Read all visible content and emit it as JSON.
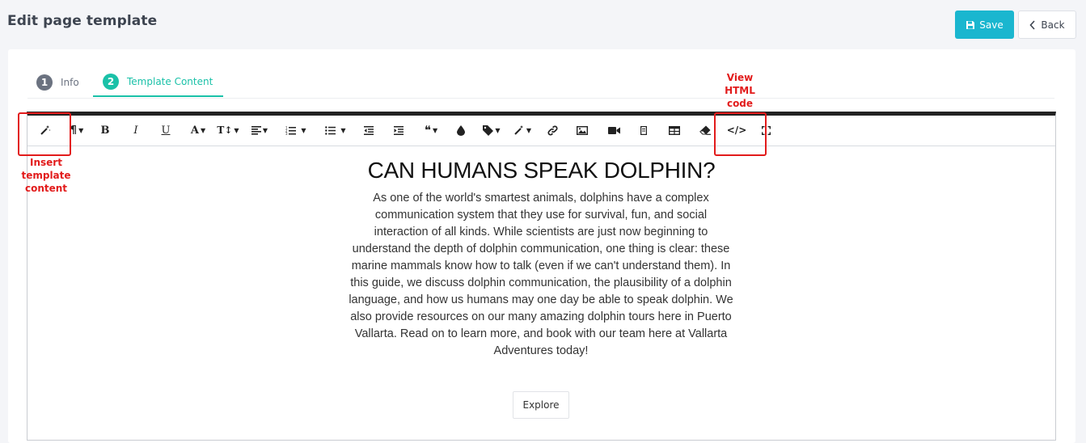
{
  "header": {
    "title": "Edit page template",
    "save_label": "Save",
    "back_label": "Back"
  },
  "tabs": [
    {
      "number": "1",
      "label": "Info",
      "active": false
    },
    {
      "number": "2",
      "label": "Template Content",
      "active": true
    }
  ],
  "toolbar": {
    "items": [
      {
        "name": "insert-template",
        "icon": "magic-wand-icon"
      },
      {
        "name": "paragraph-style",
        "icon": "pilcrow-icon",
        "glyph": "¶"
      },
      {
        "name": "bold",
        "icon": "bold-icon",
        "glyph": "B"
      },
      {
        "name": "italic",
        "icon": "italic-icon",
        "glyph": "I"
      },
      {
        "name": "underline",
        "icon": "underline-icon",
        "glyph": "U"
      },
      {
        "name": "font-color",
        "icon": "font-color-icon",
        "glyph": "A"
      },
      {
        "name": "font-size",
        "icon": "text-size-icon",
        "glyph": "T↕"
      },
      {
        "name": "align",
        "icon": "align-left-icon"
      },
      {
        "name": "ordered-list",
        "icon": "ordered-list-icon"
      },
      {
        "name": "unordered-list",
        "icon": "unordered-list-icon"
      },
      {
        "name": "outdent",
        "icon": "outdent-icon"
      },
      {
        "name": "indent",
        "icon": "indent-icon"
      },
      {
        "name": "quote",
        "icon": "quote-icon",
        "glyph": "❝"
      },
      {
        "name": "color-fill",
        "icon": "drop-icon"
      },
      {
        "name": "tag",
        "icon": "tag-icon"
      },
      {
        "name": "magic",
        "icon": "magic-wand-icon"
      },
      {
        "name": "link",
        "icon": "link-icon"
      },
      {
        "name": "image",
        "icon": "image-icon"
      },
      {
        "name": "video",
        "icon": "video-icon"
      },
      {
        "name": "file",
        "icon": "file-icon"
      },
      {
        "name": "table",
        "icon": "table-icon"
      },
      {
        "name": "clear-format",
        "icon": "eraser-icon"
      },
      {
        "name": "code-view",
        "icon": "code-icon",
        "glyph": "</>"
      },
      {
        "name": "fullscreen",
        "icon": "fullscreen-icon"
      }
    ]
  },
  "content": {
    "heading": "CAN HUMANS SPEAK DOLPHIN?",
    "paragraph": "As one of the world's smartest animals, dolphins have a complex communication system that they use for survival, fun, and social interaction of all kinds. While scientists are just now beginning to understand the depth of dolphin communication, one thing is clear: these marine mammals know how to talk (even if we can't understand them). In this guide, we discuss dolphin communication, the plausibility of a dolphin language, and how us humans may one day be able to speak dolphin. We also provide resources on our many amazing dolphin tours here in Puerto Vallarta. Read on to learn more, and book with our team here at Vallarta Adventures today!",
    "button_label": "Explore"
  },
  "annotations": {
    "insert_template": "Insert\ntemplate\ncontent",
    "view_html": "View\nHTML\ncode",
    "color": "#e21b1b"
  },
  "colors": {
    "accent": "#1ab6cf",
    "tab_active": "#1ac1a8"
  }
}
